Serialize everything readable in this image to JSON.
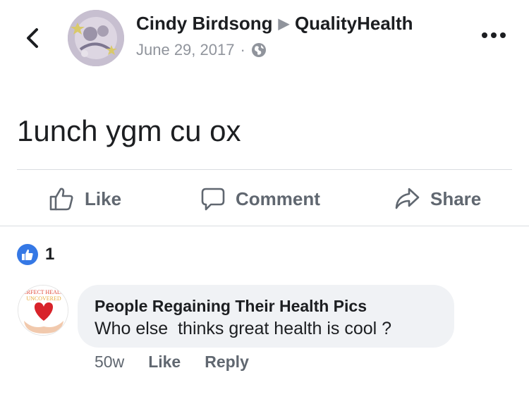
{
  "header": {
    "author": "Cindy Birdsong",
    "target_page": "QualityHealth",
    "date": "June 29, 2017",
    "separator": "·",
    "arrow_glyph": "▶"
  },
  "post": {
    "text": "1unch ygm cu ox"
  },
  "actions": {
    "like": "Like",
    "comment": "Comment",
    "share": "Share"
  },
  "reactions": {
    "count": "1"
  },
  "comment": {
    "author": "People Regaining Their Health Pics",
    "text": "Who else  thinks great health is cool ?",
    "time": "50w",
    "like": "Like",
    "reply": "Reply",
    "avatar_text_top": "PERFECT HEALTH",
    "avatar_text_bottom": "UNCOVERED"
  },
  "colors": {
    "link_blue": "#3578e5",
    "muted_gray": "#90949c",
    "action_gray": "#606770",
    "bubble_bg": "#f0f2f5"
  },
  "icons": {
    "back": "chevron-left-icon",
    "more": "more-dots-icon",
    "globe": "globe-icon",
    "like": "thumbs-up-icon",
    "comment": "comment-bubble-icon",
    "share": "share-arrow-icon"
  }
}
